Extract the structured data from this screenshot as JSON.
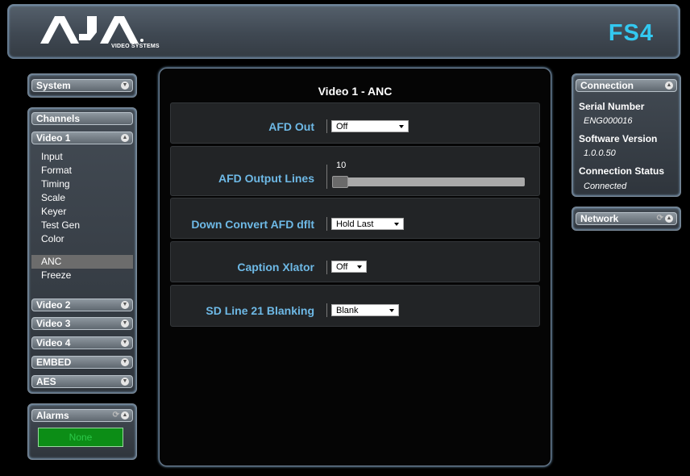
{
  "header": {
    "logo_sub": "VIDEO SYSTEMS",
    "model": "FS4",
    "logo_text": "AJA"
  },
  "sidebar": {
    "system_label": "System",
    "channels_label": "Channels",
    "video1_label": "Video 1",
    "video1_items": [
      "Input",
      "Format",
      "Timing",
      "Scale",
      "Keyer",
      "Test Gen",
      "Color",
      "ANC",
      "Freeze"
    ],
    "selected_item": "ANC",
    "other_channels": [
      "Video 2",
      "Video 3",
      "Video 4",
      "EMBED",
      "AES"
    ],
    "alarms_label": "Alarms",
    "alarms_status": "None"
  },
  "main": {
    "title": "Video 1 - ANC",
    "rows": [
      {
        "label": "AFD Out",
        "value": "Off"
      },
      {
        "label": "AFD Output Lines",
        "value": "10"
      },
      {
        "label": "Down Convert AFD dflt",
        "value": "Hold Last"
      },
      {
        "label": "Caption Xlator",
        "value": "Off"
      },
      {
        "label": "SD Line 21 Blanking",
        "value": "Blank"
      }
    ]
  },
  "connection": {
    "title": "Connection",
    "serial_label": "Serial Number",
    "serial_value": "ENG000016",
    "software_label": "Software Version",
    "software_value": "1.0.0.50",
    "status_label": "Connection Status",
    "status_value": "Connected"
  },
  "network": {
    "title": "Network"
  },
  "colors": {
    "accent": "#33c8f0",
    "label_blue": "#6eb9e6",
    "alarm_green": "#0c8d16"
  }
}
